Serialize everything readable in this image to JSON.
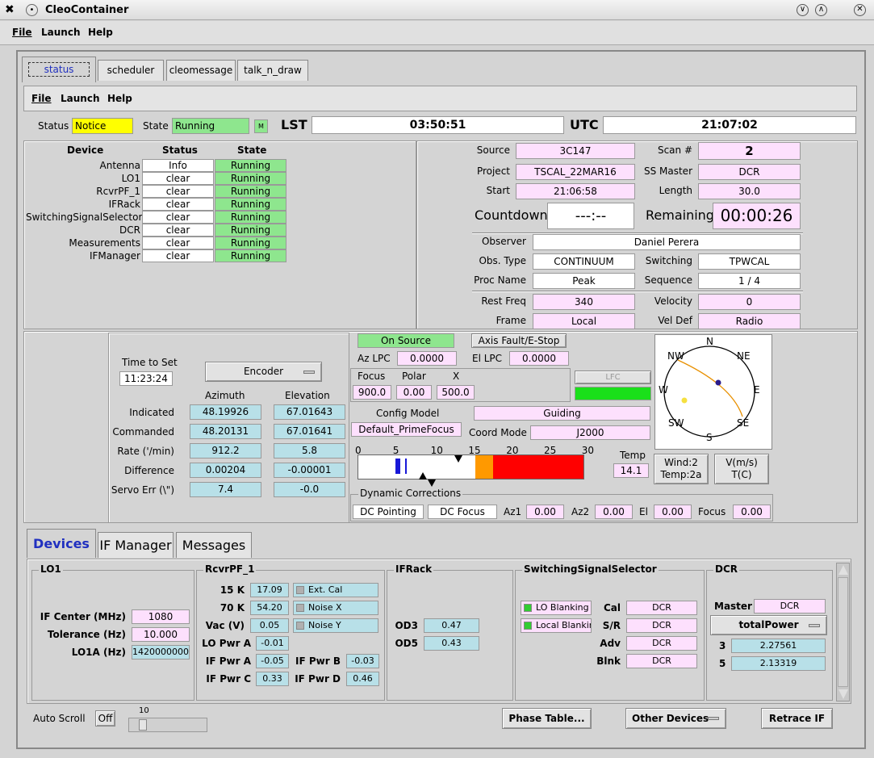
{
  "window": {
    "title": "CleoContainer"
  },
  "menu": [
    "File",
    "Launch",
    "Help"
  ],
  "tabs": [
    "status",
    "scheduler",
    "cleomessage",
    "talk_n_draw"
  ],
  "inner_menu": [
    "File",
    "Launch",
    "Help"
  ],
  "status_bar": {
    "status_label": "Status",
    "status_value": "Notice",
    "state_label": "State",
    "state_value": "Running",
    "m_btn": "M",
    "lst_label": "LST",
    "lst_value": "03:50:51",
    "utc_label": "UTC",
    "utc_value": "21:07:02"
  },
  "devices": {
    "headers": [
      "Device",
      "Status",
      "State"
    ],
    "rows": [
      {
        "name": "Antenna",
        "status": "Info",
        "state": "Running"
      },
      {
        "name": "LO1",
        "status": "clear",
        "state": "Running"
      },
      {
        "name": "RcvrPF_1",
        "status": "clear",
        "state": "Running"
      },
      {
        "name": "IFRack",
        "status": "clear",
        "state": "Running"
      },
      {
        "name": "SwitchingSignalSelector",
        "status": "clear",
        "state": "Running"
      },
      {
        "name": "DCR",
        "status": "clear",
        "state": "Running"
      },
      {
        "name": "Measurements",
        "status": "clear",
        "state": "Running"
      },
      {
        "name": "IFManager",
        "status": "clear",
        "state": "Running"
      }
    ]
  },
  "scan": {
    "source_label": "Source",
    "source": "3C147",
    "scan_label": "Scan #",
    "scan": "2",
    "project_label": "Project",
    "project": "TSCAL_22MAR16",
    "ssmaster_label": "SS Master",
    "ssmaster": "DCR",
    "start_label": "Start",
    "start": "21:06:58",
    "length_label": "Length",
    "length": "30.0",
    "countdown_label": "Countdown",
    "countdown": "---:--",
    "remaining_label": "Remaining",
    "remaining": "00:00:26",
    "observer_label": "Observer",
    "observer": "Daniel Perera",
    "obstype_label": "Obs. Type",
    "obstype": "CONTINUUM",
    "switching_label": "Switching",
    "switching": "TPWCAL",
    "procname_label": "Proc Name",
    "procname": "Peak",
    "sequence_label": "Sequence",
    "sequence": "1 / 4",
    "restfreq_label": "Rest Freq",
    "restfreq": "340",
    "velocity_label": "Velocity",
    "velocity": "0",
    "frame_label": "Frame",
    "frame": "Local",
    "veldef_label": "Vel Def",
    "veldef": "Radio"
  },
  "antenna": {
    "time_to_set_label": "Time to Set",
    "time_to_set": "11:23:24",
    "encoder": "Encoder",
    "az_header": "Azimuth",
    "el_header": "Elevation",
    "rows": [
      {
        "label": "Indicated",
        "az": "48.19926",
        "el": "67.01643"
      },
      {
        "label": "Commanded",
        "az": "48.20131",
        "el": "67.01641"
      },
      {
        "label": "Rate ('/min)",
        "az": "912.2",
        "el": "5.8"
      },
      {
        "label": "Difference",
        "az": "0.00204",
        "el": "-0.00001"
      },
      {
        "label": "Servo Err (\\\")",
        "az": "7.4",
        "el": "-0.0"
      }
    ]
  },
  "pointing": {
    "on_source": "On Source",
    "axis_fault": "Axis Fault/E-Stop",
    "azlpc_label": "Az LPC",
    "azlpc": "0.0000",
    "ellpc_label": "El LPC",
    "ellpc": "0.0000",
    "focus_label": "Focus",
    "polar_label": "Polar",
    "x_label": "X",
    "focus": "900.0",
    "polar": "0.00",
    "x": "500.0",
    "lfc": "LFC",
    "lfc2": "",
    "config_label": "Config Model",
    "config": "Guiding",
    "model": "Default_PrimeFocus",
    "coord_label": "Coord Mode",
    "coord": "J2000",
    "scale_ticks": [
      "0",
      "5",
      "10",
      "15",
      "20",
      "25",
      "30"
    ],
    "wind_value": 2,
    "temp_label": "Temp",
    "temp": "14.1",
    "wind_btn1": "Wind:2",
    "wind_btn2": "Temp:2a",
    "vms_btn1": "V(m/s)",
    "vms_btn2": "T(C)",
    "dyn_label": "Dynamic Corrections",
    "dc_pointing": "DC Pointing",
    "dc_focus": "DC Focus",
    "az1_label": "Az1",
    "az1": "0.00",
    "az2_label": "Az2",
    "az2": "0.00",
    "el_label": "El",
    "el": "0.00",
    "focus2_label": "Focus",
    "focus2": "0.00"
  },
  "compass": {
    "n": "N",
    "ne": "NE",
    "e": "E",
    "se": "SE",
    "s": "S",
    "sw": "SW",
    "w": "W",
    "nw": "NW"
  },
  "bottom_tabs": [
    "Devices",
    "IF Manager",
    "Messages"
  ],
  "lo1": {
    "title": "LO1",
    "ifcenter_label": "IF Center (MHz)",
    "ifcenter": "1080",
    "tol_label": "Tolerance (Hz)",
    "tol": "10.000",
    "lo1a_label": "LO1A (Hz)",
    "lo1a": "1420000000"
  },
  "rcvr": {
    "title": "RcvrPF_1",
    "k15_label": "15 K",
    "k15": "17.09",
    "extcal": "Ext. Cal",
    "k70_label": "70 K",
    "k70": "54.20",
    "noisex": "Noise X",
    "vac_label": "Vac (V)",
    "vac": "0.05",
    "noisey": "Noise Y",
    "lopwra_label": "LO Pwr A",
    "lopwra": "-0.01",
    "ifpwra_label": "IF Pwr A",
    "ifpwra": "-0.05",
    "ifpwrb_label": "IF Pwr B",
    "ifpwrb": "-0.03",
    "ifpwrc_label": "IF Pwr C",
    "ifpwrc": "0.33",
    "ifpwrd_label": "IF Pwr D",
    "ifpwrd": "0.46"
  },
  "ifrack": {
    "title": "IFRack",
    "od3_label": "OD3",
    "od3": "0.47",
    "od5_label": "OD5",
    "od5": "0.43"
  },
  "sss": {
    "title": "SwitchingSignalSelector",
    "lo_blanking": "LO Blanking",
    "local_blanking": "Local Blanking",
    "cal_label": "Cal",
    "cal": "DCR",
    "sr_label": "S/R",
    "sr": "DCR",
    "adv_label": "Adv",
    "adv": "DCR",
    "blnk_label": "Blnk",
    "blnk": "DCR"
  },
  "dcr": {
    "title": "DCR",
    "master_label": "Master",
    "master": "DCR",
    "mode": "totalPower",
    "ch3_label": "3",
    "ch3": "2.27561",
    "ch5_label": "5",
    "ch5": "2.13319"
  },
  "footer": {
    "autoscroll_label": "Auto Scroll",
    "autoscroll": "Off",
    "slider_value": "10",
    "phase_table": "Phase Table...",
    "other_devices": "Other Devices",
    "retrace": "Retrace IF"
  },
  "colors": {
    "pink": "#fde0fd",
    "cyan": "#b8e0e8",
    "green": "#8ee68e",
    "notice": "#ffff00"
  }
}
